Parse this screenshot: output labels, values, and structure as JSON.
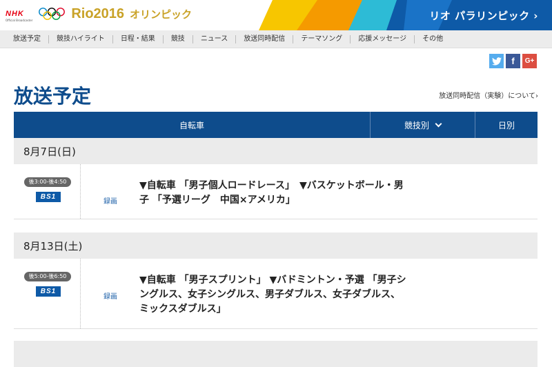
{
  "header": {
    "nhk_logo": "NHK",
    "nhk_sub": "Official Broadcaster",
    "rio_logo": "Rio2016",
    "olympic_label": "オリンピック",
    "paralympic_link": "リオ パラリンピック ›"
  },
  "nav": {
    "items": [
      "放送予定",
      "競技ハイライト",
      "日程・結果",
      "競技",
      "ニュース",
      "放送同時配信",
      "テーマソング",
      "応援メッセージ",
      "その他"
    ]
  },
  "share": {
    "twitter": "t",
    "facebook": "f",
    "google": "G+"
  },
  "page": {
    "title": "放送予定",
    "simulcast_link": "放送同時配信（実験）について›"
  },
  "table": {
    "header_main": "自転車",
    "header_sport": "競技別",
    "header_date": "日別"
  },
  "schedule": [
    {
      "date": "8月7日(日)",
      "entries": [
        {
          "time": "後3:00-後4:50",
          "channel": "BS1",
          "type": "録画",
          "program_line1": "▼自転車 「男子個人ロードレース」　▼バスケットボール・男",
          "program_line2": "子 「予選リーグ　中国×アメリカ」"
        }
      ]
    },
    {
      "date": "8月13日(土)",
      "entries": [
        {
          "time": "後5:00-後6:50",
          "channel": "BS1",
          "type": "録画",
          "program_line1": "▼自転車 「男子スプリント」 ▼バドミントン・予選 「男子シ",
          "program_line2": "ングルス、女子シングルス、男子ダブルス、女子ダブルス、",
          "program_line3": "ミックスダブルス」"
        }
      ]
    }
  ],
  "colors": {
    "primary": "#0e4c8c",
    "gold": "#c9a227",
    "nhk_red": "#e60012"
  }
}
